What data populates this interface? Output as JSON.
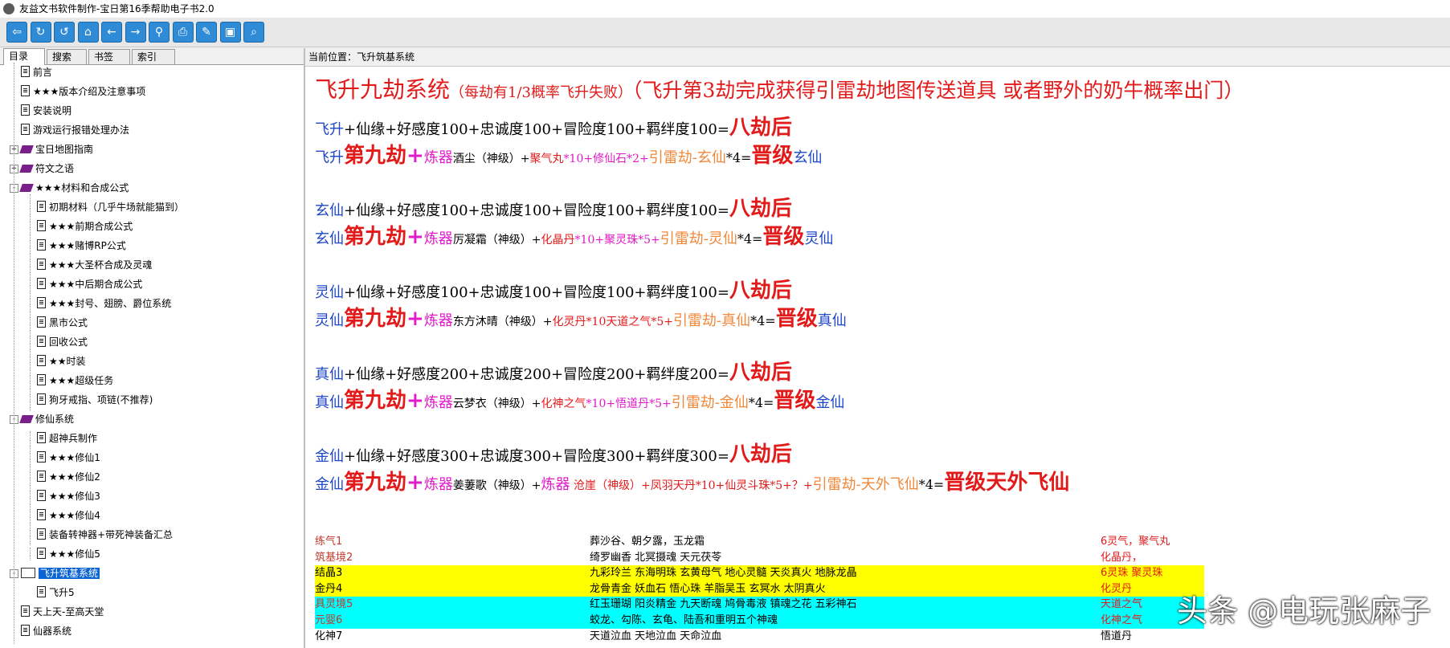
{
  "window": {
    "title": "友益文书软件制作-宝日第16季帮助电子书2.0"
  },
  "toolbar": {
    "icons": [
      "exit-icon",
      "refresh-icon",
      "reload-icon",
      "home-icon",
      "back-icon",
      "forward-icon",
      "search-icon",
      "print-icon",
      "note-icon",
      "save-icon",
      "find-icon"
    ]
  },
  "tabs": [
    {
      "label": "目录",
      "active": true
    },
    {
      "label": "搜索",
      "active": false
    },
    {
      "label": "书签",
      "active": false
    },
    {
      "label": "索引",
      "active": false
    }
  ],
  "tree": [
    {
      "label": "前言",
      "level": 1,
      "icon": "doc"
    },
    {
      "label": "★★★版本介绍及注意事项",
      "level": 1,
      "icon": "doc"
    },
    {
      "label": "安装说明",
      "level": 1,
      "icon": "doc"
    },
    {
      "label": "游戏运行报错处理办法",
      "level": 1,
      "icon": "doc"
    },
    {
      "label": "宝日地图指南",
      "level": 1,
      "icon": "book",
      "expander": "+"
    },
    {
      "label": "符文之语",
      "level": 1,
      "icon": "book",
      "expander": "+"
    },
    {
      "label": "★★★材料和合成公式",
      "level": 1,
      "icon": "book",
      "expander": "-"
    },
    {
      "label": "初期材料（几乎牛场就能猫到）",
      "level": 2,
      "icon": "doc"
    },
    {
      "label": "★★★前期合成公式",
      "level": 2,
      "icon": "doc"
    },
    {
      "label": "★★★赌博RP公式",
      "level": 2,
      "icon": "doc"
    },
    {
      "label": "★★★大圣杯合成及灵魂",
      "level": 2,
      "icon": "doc"
    },
    {
      "label": "★★★中后期合成公式",
      "level": 2,
      "icon": "doc"
    },
    {
      "label": "★★★封号、翅膀、爵位系统",
      "level": 2,
      "icon": "doc"
    },
    {
      "label": "黑市公式",
      "level": 2,
      "icon": "doc"
    },
    {
      "label": "回收公式",
      "level": 2,
      "icon": "doc"
    },
    {
      "label": "★★时装",
      "level": 2,
      "icon": "doc"
    },
    {
      "label": "★★★超级任务",
      "level": 2,
      "icon": "doc"
    },
    {
      "label": "狗牙戒指、项链(不推荐)",
      "level": 2,
      "icon": "doc"
    },
    {
      "label": "修仙系统",
      "level": 1,
      "icon": "book",
      "expander": "-"
    },
    {
      "label": "超神兵制作",
      "level": 2,
      "icon": "doc"
    },
    {
      "label": "★★★修仙1",
      "level": 2,
      "icon": "doc"
    },
    {
      "label": "★★★修仙2",
      "level": 2,
      "icon": "doc"
    },
    {
      "label": "★★★修仙3",
      "level": 2,
      "icon": "doc"
    },
    {
      "label": "★★★修仙4",
      "level": 2,
      "icon": "doc"
    },
    {
      "label": "装备转神器+带死神装备汇总",
      "level": 2,
      "icon": "doc"
    },
    {
      "label": "★★★修仙5",
      "level": 2,
      "icon": "doc"
    },
    {
      "label": "飞升筑基系统",
      "level": 1,
      "icon": "openbook",
      "expander": "-",
      "selected": true
    },
    {
      "label": "飞升5",
      "level": 2,
      "icon": "doc"
    },
    {
      "label": "天上天-至高天堂",
      "level": 1,
      "icon": "doc"
    },
    {
      "label": "仙器系统",
      "level": 1,
      "icon": "doc"
    }
  ],
  "breadcrumb": {
    "prefix": "当前位置：",
    "current": "飞升筑基系统"
  },
  "heading": {
    "main": "飞升九劫系统",
    "paren1": "（每劫有1/3概率飞升失败）",
    "paren2": "（飞升第3劫完成获得引雷劫地图传送道具 或者野外的奶牛概率出门）"
  },
  "sections": [
    {
      "req_prefix": "飞升",
      "req_body": "+仙缘+好感度100+忠诚度100+冒险度100+羁绊度100=",
      "req_result": "八劫后",
      "f_prefix": "飞升",
      "f_title": "第九劫",
      "f_plus1": "+",
      "f_item1": "炼器",
      "f_detail": "酒尘（神级）+",
      "f_item2": "聚气丸",
      "f_item2b": "*10+修仙石*2+",
      "f_item3": "引雷劫-玄仙",
      "f_mult": "*4=",
      "f_result": "晋级",
      "f_next": "玄仙"
    },
    {
      "req_prefix": "玄仙",
      "req_body": "+仙缘+好感度100+忠诚度100+冒险度100+羁绊度100=",
      "req_result": "八劫后",
      "f_prefix": "玄仙",
      "f_title": "第九劫",
      "f_plus1": "+",
      "f_item1": "炼器",
      "f_detail": "厉凝霜（神级）+",
      "f_item2": "化晶丹",
      "f_item2b": "*10+聚灵珠*5+",
      "f_item3": "引雷劫-灵仙",
      "f_mult": "*4=",
      "f_result": "晋级",
      "f_next": "灵仙"
    },
    {
      "req_prefix": "灵仙",
      "req_body": "+仙缘+好感度100+忠诚度100+冒险度100+羁绊度100=",
      "req_result": "八劫后",
      "f_prefix": "灵仙",
      "f_title": "第九劫",
      "f_plus1": "+",
      "f_item1": "炼器",
      "f_detail": "东方沐晴（神级）+",
      "f_item2": "化灵丹*10天道之气*5+",
      "f_item2b": "",
      "f_item3": "引雷劫-真仙",
      "f_mult": "*4=",
      "f_result": "晋级",
      "f_next": "真仙"
    },
    {
      "req_prefix": "真仙",
      "req_body": "+仙缘+好感度200+忠诚度200+冒险度200+羁绊度200=",
      "req_result": "八劫后",
      "f_prefix": "真仙",
      "f_title": "第九劫",
      "f_plus1": "+",
      "f_item1": "炼器",
      "f_detail": "云梦衣（神级）+",
      "f_item2": "化神之气",
      "f_item2b": "*10+悟道丹*5+",
      "f_item3": "引雷劫-金仙",
      "f_mult": "*4=",
      "f_result": "晋级",
      "f_next": "金仙"
    },
    {
      "req_prefix": "金仙",
      "req_body": "+仙缘+好感度300+忠诚度300+冒险度300+羁绊度300=",
      "req_result": "八劫后",
      "f_prefix": "金仙",
      "f_title": "第九劫",
      "f_plus1": "+",
      "f_item1": "炼器",
      "f_detail": "姜萋歌（神级）+",
      "f_item2": "炼器",
      "f_item2b": " 沧崖（神级）+凤羽天丹*10+仙灵斗珠*5+？+",
      "f_item3": "引雷劫-天外飞仙",
      "f_mult": "*4=",
      "f_result": "晋级天外飞仙",
      "f_next": ""
    }
  ],
  "table": [
    {
      "c1": "练气1",
      "c2": "葬沙谷、朝夕露，玉龙霜",
      "c3": "6灵气，聚气丸",
      "bg": "#ffffff",
      "c1color": "#c0392b",
      "c3color": "#e31a1a"
    },
    {
      "c1": "筑基境2",
      "c2": "绮罗幽香 北冥摄魂 天元茯苓",
      "c3": "化晶丹，",
      "bg": "#ffffff",
      "c1color": "#c0392b",
      "c3color": "#e31a1a"
    },
    {
      "c1": "结晶3",
      "c2": "九彩玲兰 东海明珠 玄黄母气 地心灵髓 天炎真火 地脉龙晶",
      "c3": "6灵珠 聚灵珠",
      "bg": "#ffff00",
      "c1color": "#000000",
      "c3color": "#e31a1a"
    },
    {
      "c1": "金丹4",
      "c2": "龙骨青金 妖血石  悟心珠 羊脂吴玉 玄冥水 太阴真火",
      "c3": "化灵丹",
      "bg": "#ffff00",
      "c1color": "#000000",
      "c3color": "#e31a1a"
    },
    {
      "c1": "具灵境5",
      "c2": "红玉珊瑚  阳炎精金   九天断魂  鸠骨毒液 镇魂之花 五彩神石",
      "c3": "天道之气",
      "bg": "#00ffff",
      "c1color": "#c0392b",
      "c3color": "#e31a1a"
    },
    {
      "c1": "元婴6",
      "c2": "蛟龙、勾陈、玄龟、陆吾和重明五个神魂",
      "c3": "化神之气",
      "bg": "#00ffff",
      "c1color": "#c0392b",
      "c3color": "#e31a1a"
    },
    {
      "c1": "化神7",
      "c2": "天道泣血 天地泣血 天命泣血",
      "c3": "悟道丹",
      "bg": "#ffffff",
      "c1color": "#000000",
      "c3color": "#000000"
    }
  ],
  "watermark": "头条 @电玩张麻子"
}
